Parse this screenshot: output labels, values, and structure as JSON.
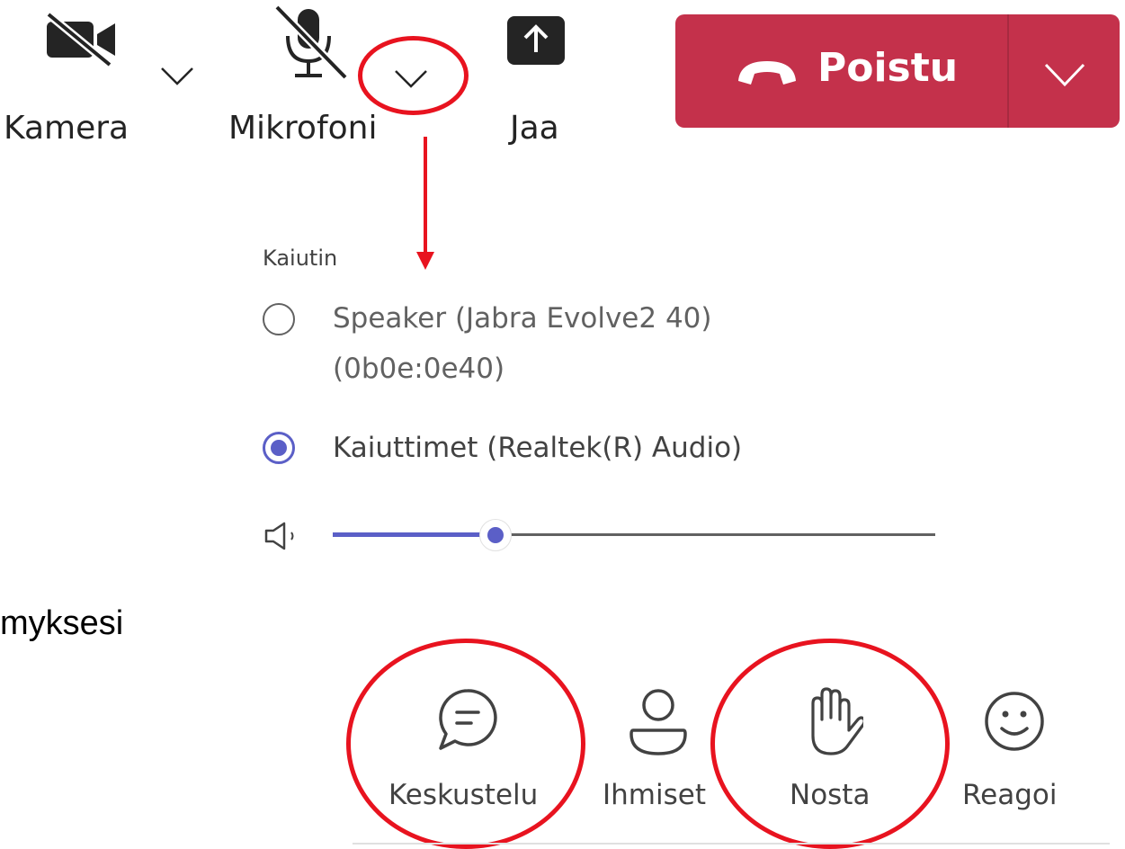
{
  "toolbar": {
    "camera_label": "Kamera",
    "microphone_label": "Mikrofoni",
    "share_label": "Jaa",
    "leave_label": "Poistu"
  },
  "device_menu": {
    "section_header": "Kaiutin",
    "options": [
      {
        "label_line1": "Speaker (Jabra Evolve2 40)",
        "label_line2": "(0b0e:0e40)",
        "selected": false
      },
      {
        "label_line1": "Kaiuttimet (Realtek(R) Audio)",
        "selected": true
      }
    ],
    "volume_level": 0.27
  },
  "background_text": "myksesi",
  "bottom_bar": {
    "chat_label": "Keskustelu",
    "people_label": "Ihmiset",
    "raise_hand_label": "Nosta",
    "react_label": "Reagoi"
  },
  "colors": {
    "leave_red": "#c4314b",
    "accent": "#5b5fc7",
    "annotation_red": "#e8131f"
  },
  "icons": {
    "camera": "video-off-icon",
    "microphone": "mic-off-icon",
    "share": "share-upload-icon",
    "leave": "phone-hangup-icon",
    "speaker": "speaker-icon",
    "chat": "chat-bubble-icon",
    "people": "person-icon",
    "raise_hand": "hand-icon",
    "react": "smiley-icon"
  }
}
